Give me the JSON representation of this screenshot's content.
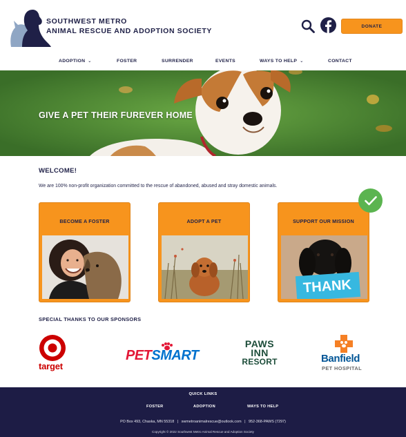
{
  "header": {
    "org_name_line1": "SOUTHWEST METRO",
    "org_name_line2": "ANIMAL RESCUE AND ADOPTION SOCIETY",
    "donate_label": "DONATE",
    "icons": [
      "dog-cat-logo-icon",
      "search-icon",
      "facebook-icon"
    ]
  },
  "nav": {
    "items": [
      {
        "label": "ADOPTION",
        "has_dropdown": true
      },
      {
        "label": "FOSTER",
        "has_dropdown": false
      },
      {
        "label": "SURRENDER",
        "has_dropdown": false
      },
      {
        "label": "EVENTS",
        "has_dropdown": false
      },
      {
        "label": "WAYS TO HELP",
        "has_dropdown": true
      },
      {
        "label": "CONTACT",
        "has_dropdown": false
      }
    ]
  },
  "hero": {
    "title": "GIVE A PET THEIR FUREVER HOME"
  },
  "welcome": {
    "heading": "WELCOME!",
    "text": "We are 100% non-profit organization committed to the rescue of abandoned, abused and stray domestic animals."
  },
  "cards": [
    {
      "label": "BECOME A FOSTER"
    },
    {
      "label": "ADOPT A PET"
    },
    {
      "label": "SUPPORT OUR MISSION",
      "photo_text": "THANK"
    }
  ],
  "sponsors": {
    "heading": "SPECIAL THANKS TO OUR SPONSORS",
    "target": "target",
    "petsmart_pet": "PET",
    "petsmart_smart": "SMART",
    "pawsinn_line1": "PAWS",
    "pawsinn_line2": "INN",
    "pawsinn_line3": "RESORT",
    "banfield_name": "Banfield",
    "banfield_sub": "PET HOSPITAL"
  },
  "footer": {
    "heading": "QUICK LINKS",
    "links": [
      "FOSTER",
      "ADOPTION",
      "WAYS TO HELP"
    ],
    "contact": "PO Box 493, Chaska, MN 55318   |   swmetroanimalrescue@outlook.com   |   952-368-PAWS (7297)",
    "copyright": "Copyright © 2022 Southwest Metro Animal Rescue and Adoption Society"
  },
  "colors": {
    "navy": "#1f2047",
    "orange": "#f7941d",
    "footer_bg": "#1d1c45",
    "check_green": "#5bb450",
    "target_red": "#cc0000",
    "petsmart_red": "#e31837",
    "petsmart_blue": "#0071ce",
    "pawsinn_green": "#1d4d3a",
    "banfield_blue": "#005596",
    "banfield_orange": "#f58025"
  }
}
